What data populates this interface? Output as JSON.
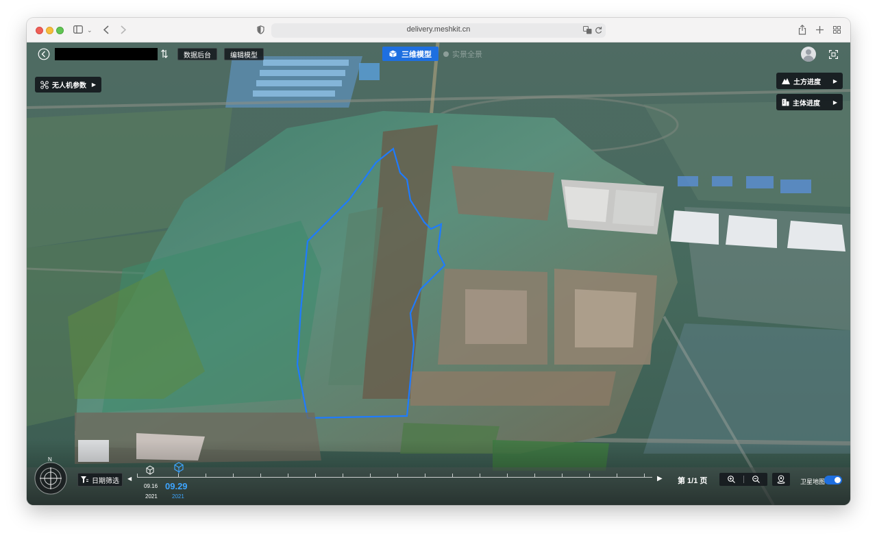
{
  "browser": {
    "url": "delivery.meshkit.cn"
  },
  "top_bar": {
    "data_backend_label": "数据后台",
    "edit_model_label": "编辑模型",
    "tab_3d_label": "三维模型",
    "tab_panorama_label": "实景全景"
  },
  "left_panel": {
    "drone_params_label": "无人机参数"
  },
  "right_panel": {
    "earthwork_label": "土方进度",
    "main_structure_label": "主体进度"
  },
  "bottom_bar": {
    "date_filter_label": "日期筛选",
    "compass_n": "N",
    "start_date": "09.16",
    "start_year": "2021",
    "current_date": "09.29",
    "current_year": "2021",
    "page_label": "第 1/1 页",
    "satellite_label": "卫星地图",
    "satellite_on": true
  },
  "colors": {
    "accent": "#1e6fe0",
    "highlight": "#3ea5ff",
    "panel": "#14181c"
  },
  "icons": [
    "back-icon",
    "swap-icon",
    "drone-icon",
    "cube-icon",
    "avatar-icon",
    "fullscreen-icon",
    "earthwork-icon",
    "structure-icon",
    "compass-icon",
    "filter-icon",
    "play-icon",
    "zoom-in-icon",
    "zoom-out-icon",
    "location-icon"
  ]
}
